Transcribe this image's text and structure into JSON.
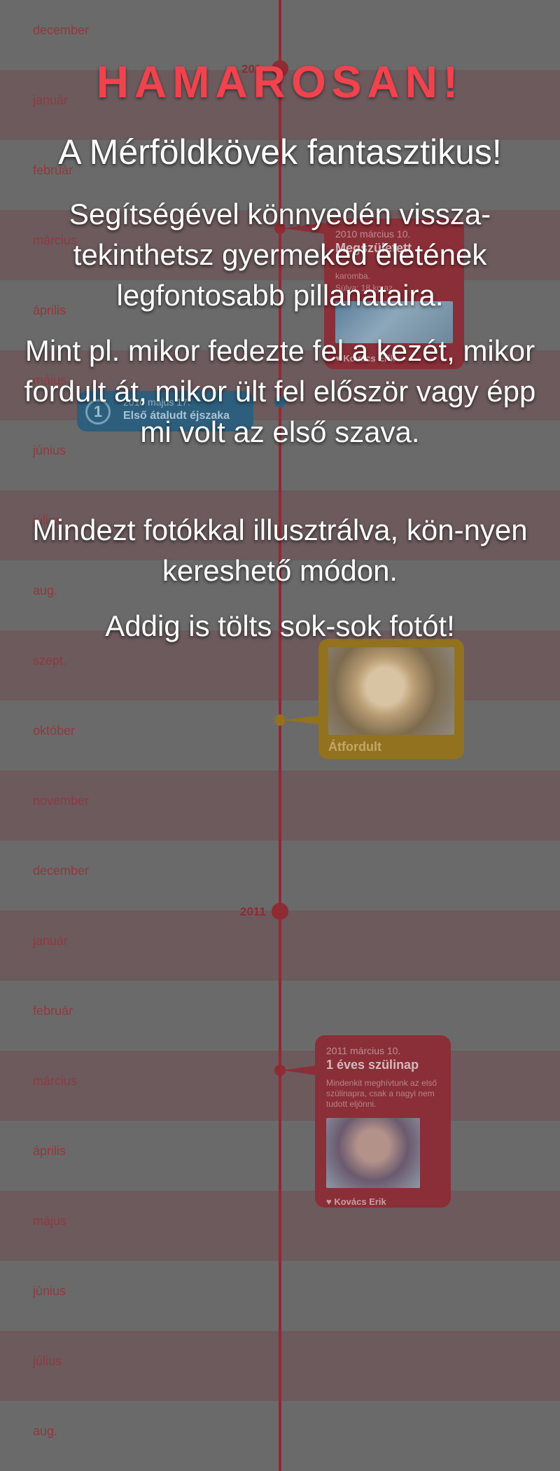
{
  "timeline": {
    "months": [
      "december",
      "január",
      "február",
      "március",
      "április",
      "május",
      "június",
      "július",
      "aug.",
      "szept.",
      "október",
      "november",
      "december",
      "január",
      "február",
      "március",
      "április",
      "május",
      "június",
      "július",
      "aug."
    ],
    "year_2011": "2011",
    "year_2010_partial": "201",
    "card_birth": {
      "date": "2010 március 10.",
      "title": "Megszületett",
      "desc_line1": "karomba.",
      "desc_line2": "Súlya: 18 kg az",
      "author": "Kovács Erik"
    },
    "card_sleep": {
      "number": "1",
      "date": "2010 május 17.",
      "title": "Első átaludt éjszaka"
    },
    "card_turn": {
      "title": "Átfordult"
    },
    "card_birthday": {
      "date": "2011 március 10.",
      "title": "1 éves szülinap",
      "desc": "Mindenkit meghívtunk az első szülinapra, csak a nagyi nem tudott eljönni.",
      "author": "Kovács Erik"
    }
  },
  "overlay": {
    "headline": "HAMAROSAN!",
    "subheadline": "A Mérföldkövek fantasztikus!",
    "paragraph1": "Segítségével könnyedén vissza-tekinthetsz gyermeked életének legfontosabb pillanataira.",
    "paragraph2": "Mint pl. mikor fedezte fel a kezét, mikor fordult át, mikor ült fel először vagy épp mi volt az első szava.",
    "paragraph3": "Mindezt fotókkal illusztrálva, kön-nyen kereshető módon.",
    "paragraph4": "Addig is tölts sok-sok fotót!"
  },
  "colors": {
    "accent_red": "#f0434e",
    "timeline_red": "#8f2b33",
    "milestone_gold": "#92721f",
    "milestone_blue": "#2d5f7d"
  },
  "icons": [
    "heart-icon",
    "milestone-number-badge"
  ]
}
